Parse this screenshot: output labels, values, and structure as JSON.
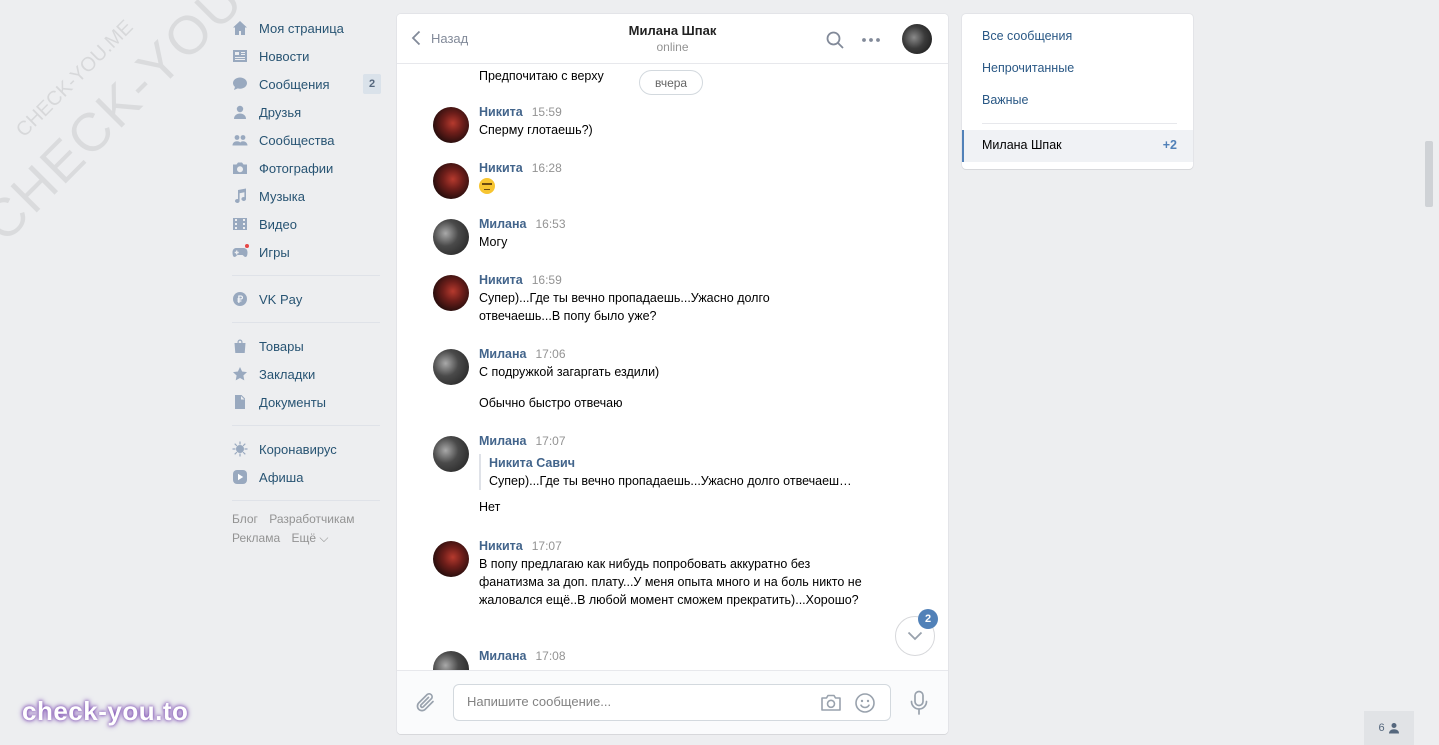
{
  "watermark": {
    "big": "CHECK-YOU.ME",
    "small": "CHECK-YOU.ME",
    "brand": "check-you.to"
  },
  "sidebar": {
    "items": [
      {
        "label": "Моя страница",
        "icon": "home-icon"
      },
      {
        "label": "Новости",
        "icon": "news-icon"
      },
      {
        "label": "Сообщения",
        "icon": "messages-icon",
        "count": "2"
      },
      {
        "label": "Друзья",
        "icon": "friends-icon"
      },
      {
        "label": "Сообщества",
        "icon": "communities-icon"
      },
      {
        "label": "Фотографии",
        "icon": "camera-icon"
      },
      {
        "label": "Музыка",
        "icon": "music-icon"
      },
      {
        "label": "Видео",
        "icon": "video-icon"
      },
      {
        "label": "Игры",
        "icon": "games-icon"
      },
      {
        "label": "VK Pay",
        "icon": "vkpay-icon"
      },
      {
        "label": "Товары",
        "icon": "bag-icon"
      },
      {
        "label": "Закладки",
        "icon": "star-icon"
      },
      {
        "label": "Документы",
        "icon": "document-icon"
      },
      {
        "label": "Коронавирус",
        "icon": "virus-icon"
      },
      {
        "label": "Афиша",
        "icon": "play-icon"
      }
    ],
    "footer": {
      "blog": "Блог",
      "developers": "Разработчикам",
      "ads": "Реклама",
      "more": "Ещё ⌵"
    }
  },
  "chat": {
    "back_label": "Назад",
    "peer_name": "Милана Шпак",
    "peer_status": "online",
    "date_label": "вчера",
    "first_text": "Предпочитаю с верху",
    "messages": [
      {
        "author": "Никита",
        "time": "15:59",
        "text": "Сперму глотаешь?)"
      },
      {
        "author": "Никита",
        "time": "16:28",
        "emoji": "grimace-emoji"
      },
      {
        "author": "Милана",
        "time": "16:53",
        "text": "Могу"
      },
      {
        "author": "Никита",
        "time": "16:59",
        "text": "Супер)...Где ты вечно пропадаешь...Ужасно долго отвечаешь...В попу было уже?"
      },
      {
        "author": "Милана",
        "time": "17:06",
        "text": "С подружкой загаргать ездили)",
        "text2": "Обычно быстро отвечаю"
      },
      {
        "author": "Милана",
        "time": "17:07",
        "fwd_author": "Никита Савич",
        "fwd_text": "Супер)...Где ты вечно пропадаешь...Ужасно долго отвечаеш…",
        "text": "Нет"
      },
      {
        "author": "Никита",
        "time": "17:07",
        "text": "В попу предлагаю как нибудь попробовать аккуратно без фанатизма за доп. плату...У меня опыта много и на боль никто не жаловался ещё..В любой момент сможем прекратить)...Хорошо?"
      },
      {
        "author": "Милана",
        "time": "17:08"
      }
    ],
    "unread_badge": "2",
    "composer": {
      "placeholder": "Напишите сообщение..."
    }
  },
  "right_panel": {
    "all": "Все сообщения",
    "unread": "Непрочитанные",
    "important": "Важные",
    "conversation": {
      "name": "Милана Шпак",
      "count": "+2"
    }
  },
  "viewers_count": "6",
  "colors": {
    "background": "#edeef0",
    "link": "#2a5885",
    "author": "#42648b",
    "accent": "#5181b8"
  }
}
